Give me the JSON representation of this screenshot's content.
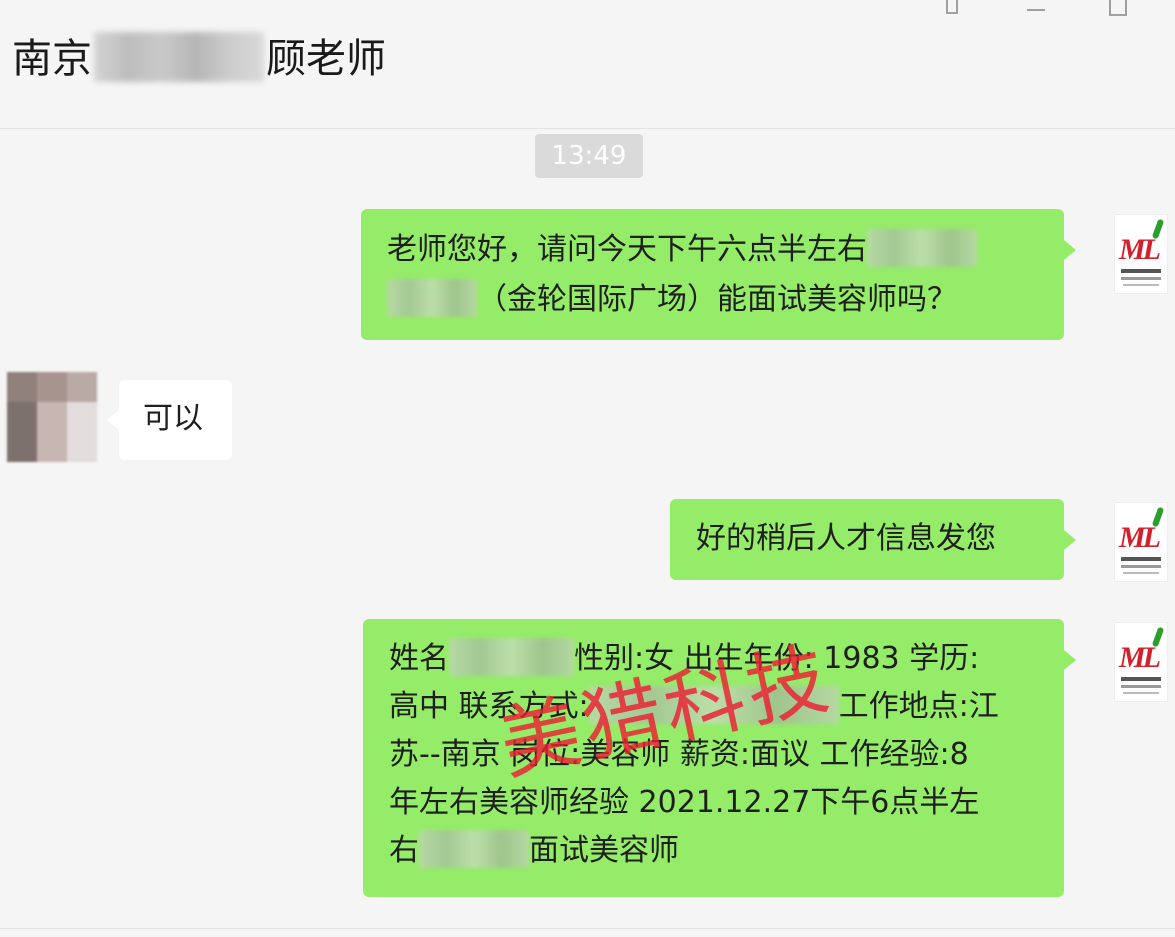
{
  "header": {
    "title_prefix": "南京",
    "title_suffix": "顾老师"
  },
  "window_controls": {
    "pin_icon": "pin-icon",
    "minimize_icon": "minimize-icon",
    "maximize_icon": "maximize-icon"
  },
  "chat": {
    "timestamp": "13:49",
    "messages": [
      {
        "side": "right",
        "lines": [
          "老师您好，请问今天下午六点半左右",
          "（金轮国际广场）能面试美容师吗？"
        ]
      },
      {
        "side": "left",
        "text": "可以"
      },
      {
        "side": "right",
        "text": "好的稍后人才信息发您"
      },
      {
        "side": "right",
        "lines": [
          "姓名",
          "性别:女 出生年份: 1983 学历:",
          "高中 联系方式:",
          "工作地点:江",
          "苏--南京 岗位:美容师 薪资:面议 工作经验:8",
          "年左右美容师经验 2021.12.27下午6点半左",
          "右",
          "面试美容师"
        ]
      }
    ]
  },
  "watermark": "美猎科技",
  "brand_avatar": {
    "logo_text": "ML"
  },
  "colors": {
    "self_bubble": "#95ec69",
    "other_bubble": "#ffffff",
    "background": "#f5f5f5",
    "watermark": "#ec1e32"
  }
}
